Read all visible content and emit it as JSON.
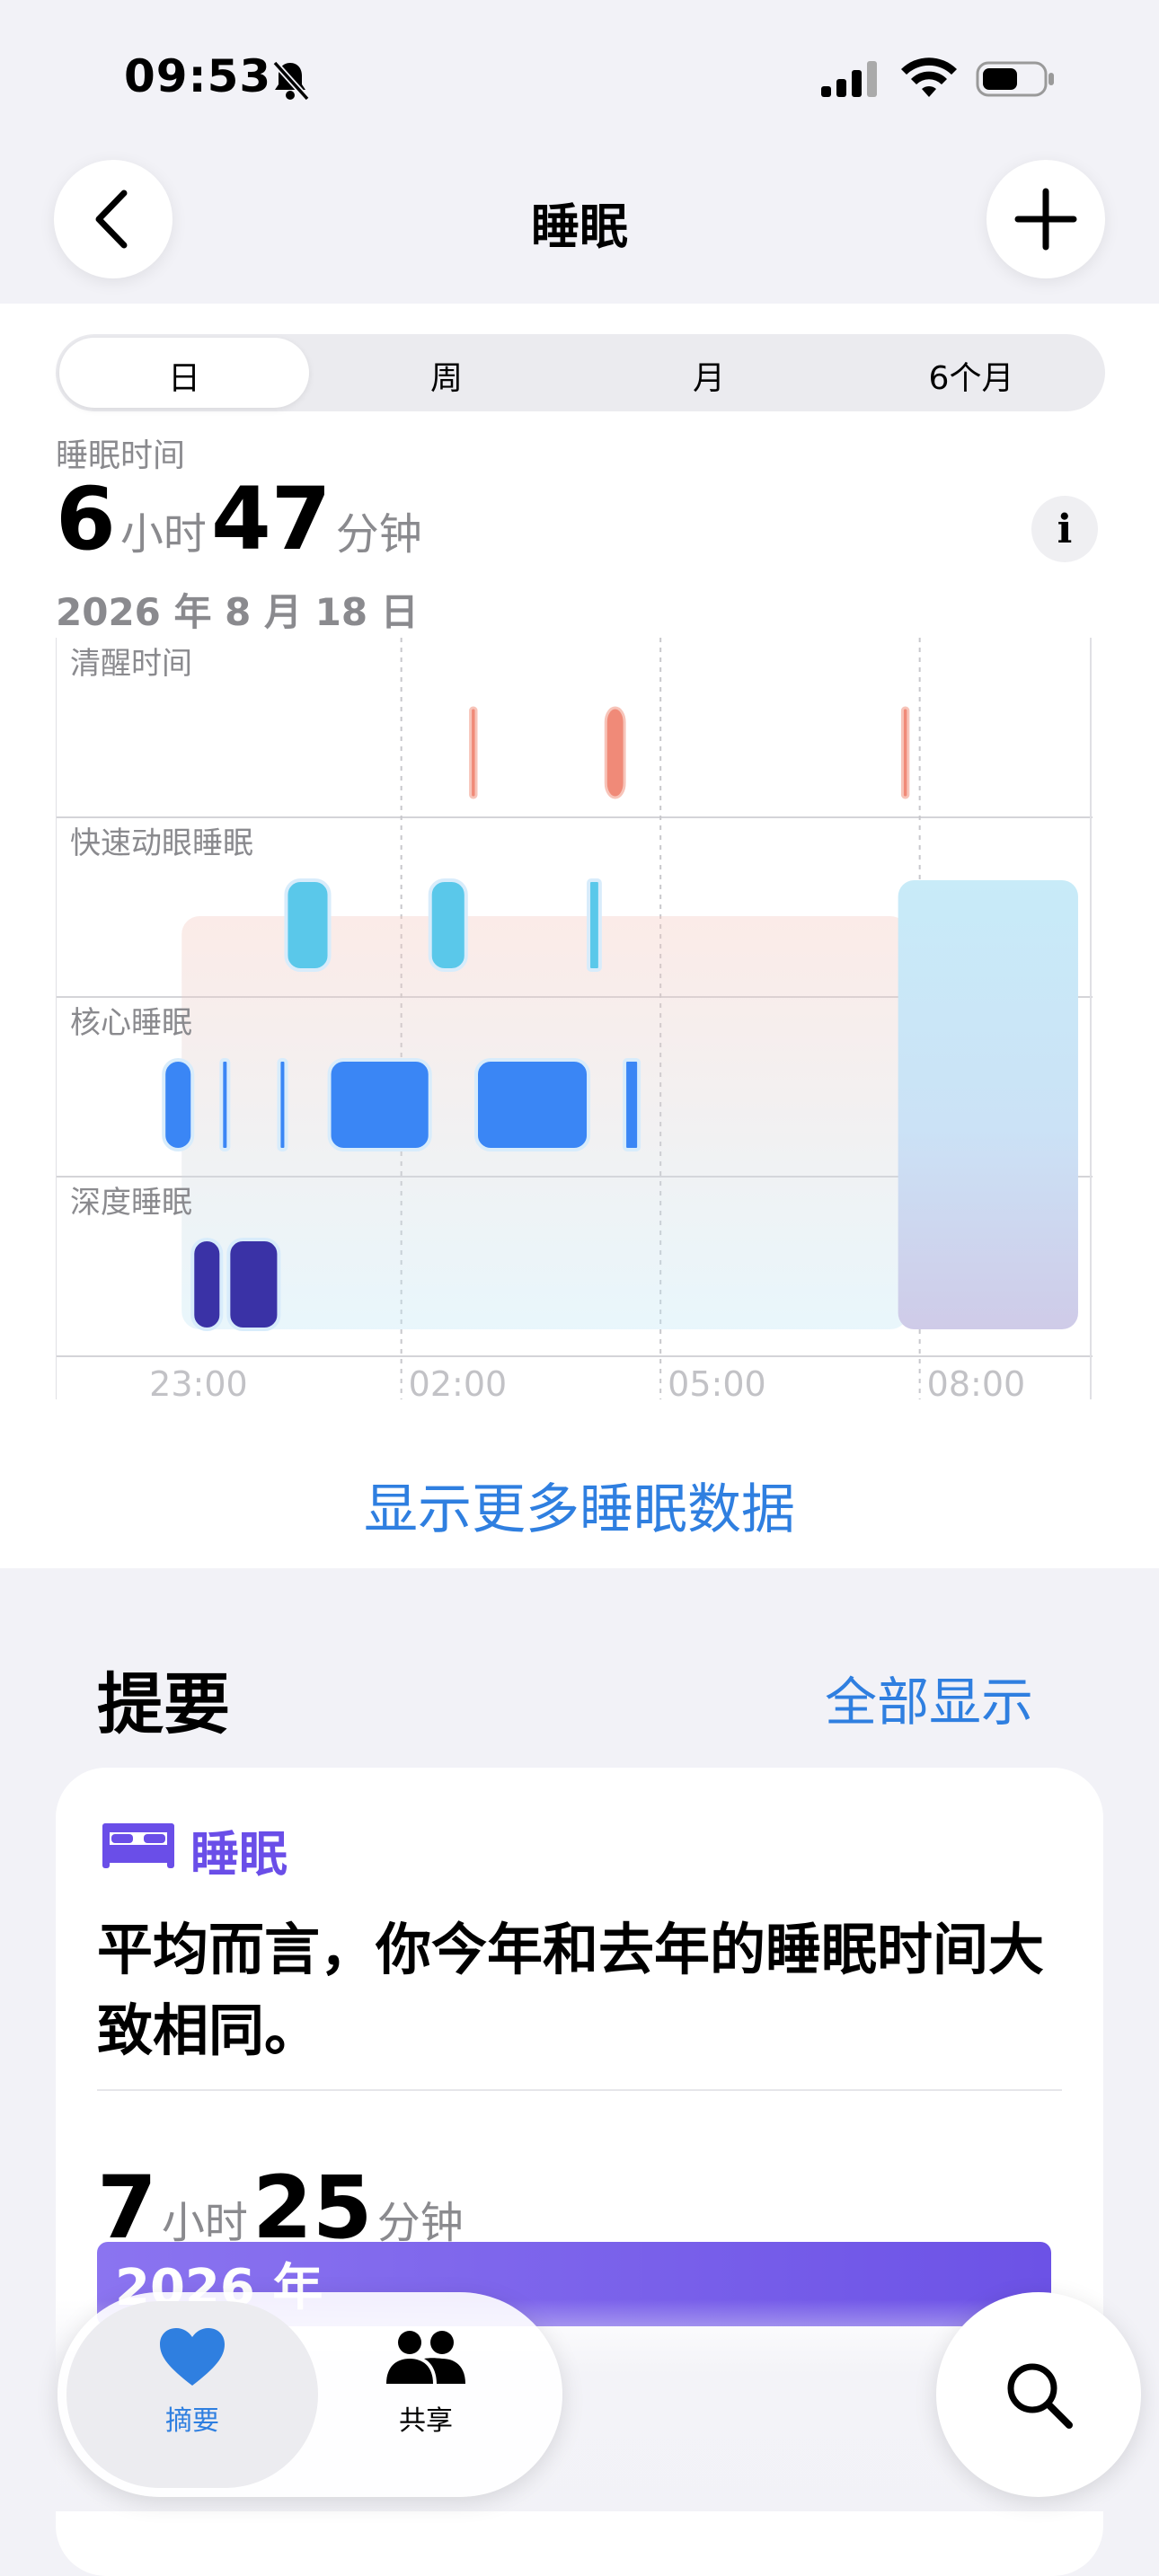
{
  "status": {
    "time": "09:53"
  },
  "nav": {
    "title": "睡眠",
    "back_icon": "chevron-left-icon",
    "add_icon": "plus-icon"
  },
  "segments": [
    "日",
    "周",
    "月",
    "6个月"
  ],
  "selected_segment": "日",
  "stat": {
    "label": "睡眠时间",
    "hours": "6",
    "hours_unit": "小时",
    "minutes": "47",
    "minutes_unit": "分钟",
    "date": "2026 年 8 月 18 日"
  },
  "chart_data": {
    "type": "timeline",
    "stages": [
      "清醒时间",
      "快速动眼睡眠",
      "核心睡眠",
      "深度睡眠"
    ],
    "x_ticks": [
      "23:00",
      "02:00",
      "05:00",
      "08:00"
    ],
    "x_range": [
      "22:00",
      "10:00"
    ],
    "colors": {
      "awake": "#f08a78",
      "rem": "#5ac8ea",
      "core": "#3a86f5",
      "deep": "#3a32a6",
      "unknown": "#c8e8f6"
    },
    "segments": [
      {
        "stage": "core",
        "start": "23:15",
        "end": "23:35"
      },
      {
        "stage": "deep",
        "start": "23:35",
        "end": "23:55"
      },
      {
        "stage": "core",
        "start": "23:55",
        "end": "24:00"
      },
      {
        "stage": "deep",
        "start": "24:00",
        "end": "24:35"
      },
      {
        "stage": "core",
        "start": "24:35",
        "end": "24:40"
      },
      {
        "stage": "rem",
        "start": "24:40",
        "end": "25:10"
      },
      {
        "stage": "core",
        "start": "25:10",
        "end": "26:20"
      },
      {
        "stage": "rem",
        "start": "26:20",
        "end": "26:45"
      },
      {
        "stage": "awake",
        "start": "26:48",
        "end": "26:52"
      },
      {
        "stage": "core",
        "start": "26:52",
        "end": "28:10"
      },
      {
        "stage": "rem",
        "start": "28:10",
        "end": "28:18"
      },
      {
        "stage": "awake",
        "start": "28:22",
        "end": "28:35"
      },
      {
        "stage": "core",
        "start": "28:35",
        "end": "28:45"
      },
      {
        "stage": "awake",
        "start": "31:48",
        "end": "31:52"
      },
      {
        "stage": "unknown",
        "start": "31:45",
        "end": "33:50"
      }
    ]
  },
  "more_link": "显示更多睡眠数据",
  "summary": {
    "title": "提要",
    "show_all": "全部显示",
    "card": {
      "category": "睡眠",
      "icon": "bed-icon",
      "text": "平均而言，你今年和去年的睡眠时间大致相同。",
      "hours": "7",
      "hours_unit": "小时",
      "minutes": "25",
      "minutes_unit": "分钟",
      "bar_label": "2026 年"
    }
  },
  "tabs": [
    {
      "label": "摘要",
      "icon": "heart-icon",
      "active": true
    },
    {
      "label": "共享",
      "icon": "people-icon",
      "active": false
    }
  ],
  "search_icon": "search-icon",
  "accent": "#2f7fe0"
}
